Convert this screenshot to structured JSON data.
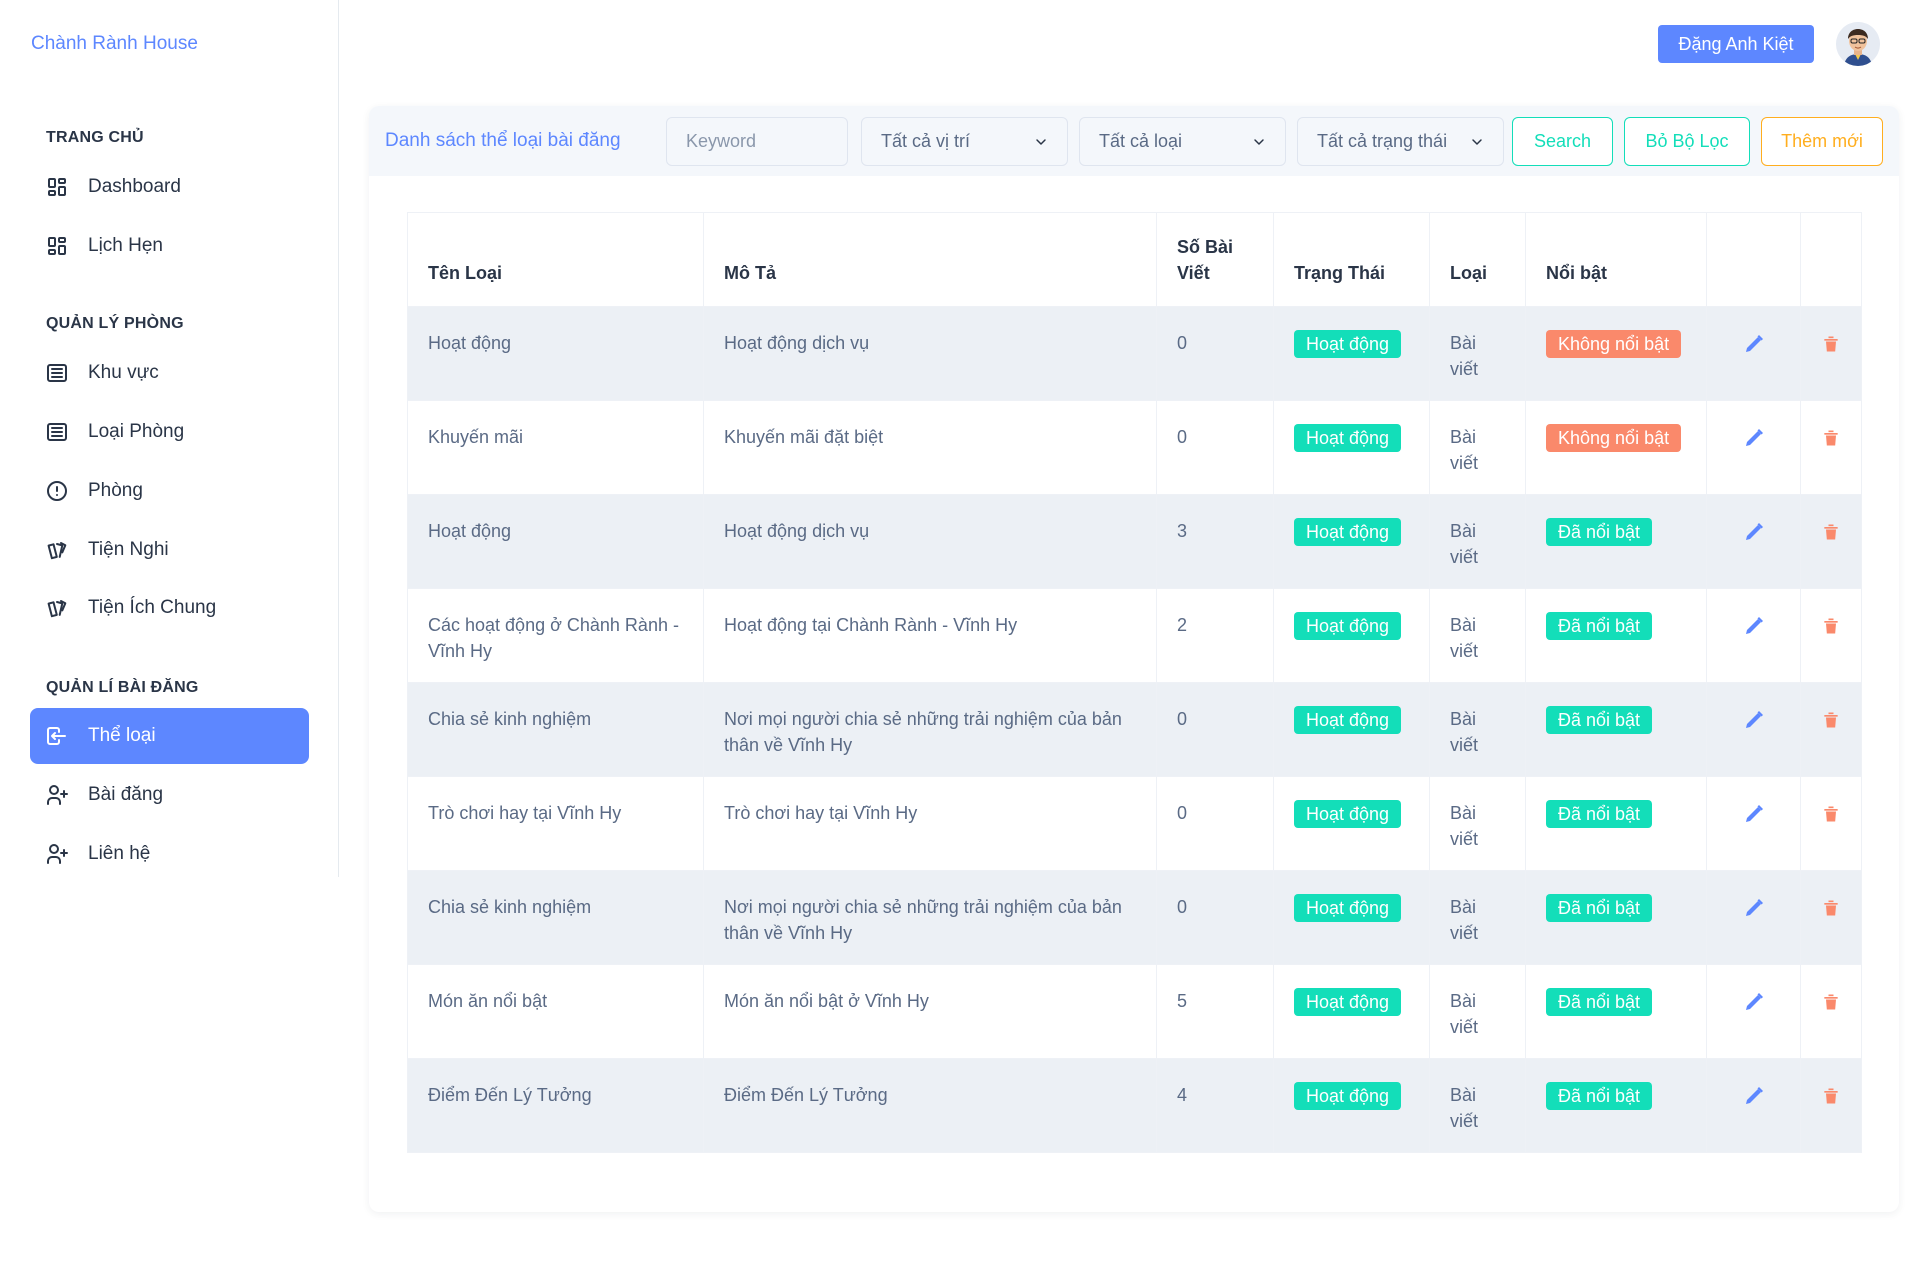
{
  "brand": "Chành Rành House",
  "sidebar": {
    "sections": [
      {
        "title": "TRANG CHỦ",
        "items": [
          {
            "label": "Dashboard",
            "icon": "layout-dashboard-icon"
          },
          {
            "label": "Lịch Hẹn",
            "icon": "layout-dashboard-icon"
          }
        ]
      },
      {
        "title": "QUẢN LÝ PHÒNG",
        "items": [
          {
            "label": "Khu vực",
            "icon": "article-icon"
          },
          {
            "label": "Loại Phòng",
            "icon": "article-icon"
          },
          {
            "label": "Phòng",
            "icon": "alert-circle-icon"
          },
          {
            "label": "Tiện Nghi",
            "icon": "cards-icon"
          },
          {
            "label": "Tiện Ích Chung",
            "icon": "cards-icon"
          }
        ]
      },
      {
        "title": "QUẢN LÍ BÀI ĐĂNG",
        "items": [
          {
            "label": "Thể loại",
            "icon": "login-icon",
            "active": true
          },
          {
            "label": "Bài đăng",
            "icon": "user-plus-icon"
          },
          {
            "label": "Liên hệ",
            "icon": "user-plus-icon"
          }
        ]
      }
    ]
  },
  "header": {
    "user_name": "Đặng Anh Kiệt"
  },
  "toolbar": {
    "title": "Danh sách thể loại bài đăng",
    "keyword_placeholder": "Keyword",
    "location_select": "Tất cả vị trí",
    "type_select": "Tất cả loại",
    "status_select": "Tất cả trạng thái",
    "search_label": "Search",
    "clear_label": "Bỏ Bộ Lọc",
    "add_label": "Thêm mới"
  },
  "table": {
    "headers": [
      "Tên Loại",
      "Mô Tả",
      "Số Bài Viết",
      "Trạng Thái",
      "Loại",
      "Nổi bật",
      "",
      ""
    ],
    "rows": [
      {
        "name": "Hoạt động",
        "desc": "Hoạt động dịch vụ",
        "count": "0",
        "status": "Hoạt động",
        "type": "Bài viết",
        "featured": "Không nổi bật",
        "featured_color": "#fa896b"
      },
      {
        "name": "Khuyến mãi",
        "desc": "Khuyến mãi đặt biệt",
        "count": "0",
        "status": "Hoạt động",
        "type": "Bài viết",
        "featured": "Không nổi bật",
        "featured_color": "#fa896b"
      },
      {
        "name": "Hoạt động",
        "desc": "Hoạt động dịch vụ",
        "count": "3",
        "status": "Hoạt động",
        "type": "Bài viết",
        "featured": "Đã nổi bật",
        "featured_color": "#13deb9"
      },
      {
        "name": "Các hoạt động ở Chành Rành - Vĩnh Hy",
        "desc": "Hoạt động tại Chành Rành - Vĩnh Hy",
        "count": "2",
        "status": "Hoạt động",
        "type": "Bài viết",
        "featured": "Đã nổi bật",
        "featured_color": "#13deb9"
      },
      {
        "name": "Chia sẻ kinh nghiệm",
        "desc": "Nơi mọi người chia sẻ những trải nghiệm của bản thân về Vĩnh Hy",
        "count": "0",
        "status": "Hoạt động",
        "type": "Bài viết",
        "featured": "Đã nổi bật",
        "featured_color": "#13deb9"
      },
      {
        "name": "Trò chơi hay tại Vĩnh Hy",
        "desc": "Trò chơi hay tại Vĩnh Hy",
        "count": "0",
        "status": "Hoạt động",
        "type": "Bài viết",
        "featured": "Đã nổi bật",
        "featured_color": "#13deb9"
      },
      {
        "name": "Chia sẻ kinh nghiệm",
        "desc": "Nơi mọi người chia sẻ những trải nghiệm của bản thân về Vĩnh Hy",
        "count": "0",
        "status": "Hoạt động",
        "type": "Bài viết",
        "featured": "Đã nổi bật",
        "featured_color": "#13deb9"
      },
      {
        "name": "Món ăn nổi bật",
        "desc": "Món ăn nổi bật ở Vĩnh Hy",
        "count": "5",
        "status": "Hoạt động",
        "type": "Bài viết",
        "featured": "Đã nổi bật",
        "featured_color": "#13deb9"
      },
      {
        "name": "Điểm Đến Lý Tưởng",
        "desc": "Điểm Đến Lý Tưởng",
        "count": "4",
        "status": "Hoạt động",
        "type": "Bài viết",
        "featured": "Đã nổi bật",
        "featured_color": "#13deb9"
      }
    ]
  },
  "colors": {
    "primary": "#5d87ff",
    "success": "#13deb9",
    "danger": "#fa896b",
    "warning": "#ffae1f",
    "edit_icon": "#5d87ff",
    "delete_icon": "#fa896b"
  }
}
